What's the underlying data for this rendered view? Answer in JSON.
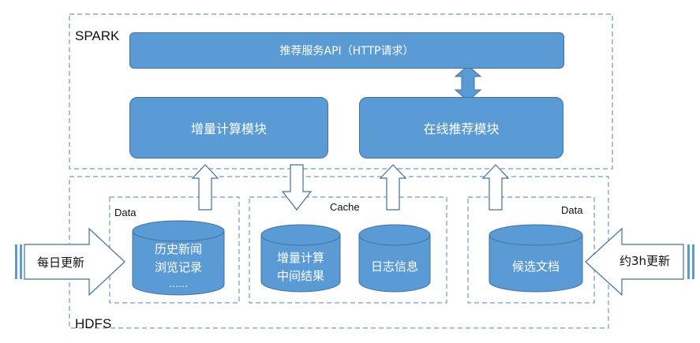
{
  "colors": {
    "fill": "#5b9bd5",
    "stroke": "#41719c",
    "dashed": "#6e9ac4",
    "arrow_fill": "#ffffff",
    "text_dark": "#111111",
    "text_light": "#ffffff"
  },
  "spark": {
    "label": "SPARK",
    "api": "推荐服务API（HTTP请求）",
    "incremental_module": "增量计算模块",
    "online_module": "在线推荐模块"
  },
  "hdfs": {
    "label": "HDFS",
    "data_left": {
      "label": "Data",
      "store": {
        "line1": "历史新闻",
        "line2": "浏览记录",
        "line3": "……"
      }
    },
    "cache": {
      "label": "Cache",
      "intermediate": {
        "line1": "增量计算",
        "line2": "中间结果"
      },
      "log": "日志信息"
    },
    "data_right": {
      "label": "Data",
      "store": "候选文档"
    }
  },
  "inputs": {
    "daily": "每日更新",
    "hourly": "约3h更新"
  }
}
